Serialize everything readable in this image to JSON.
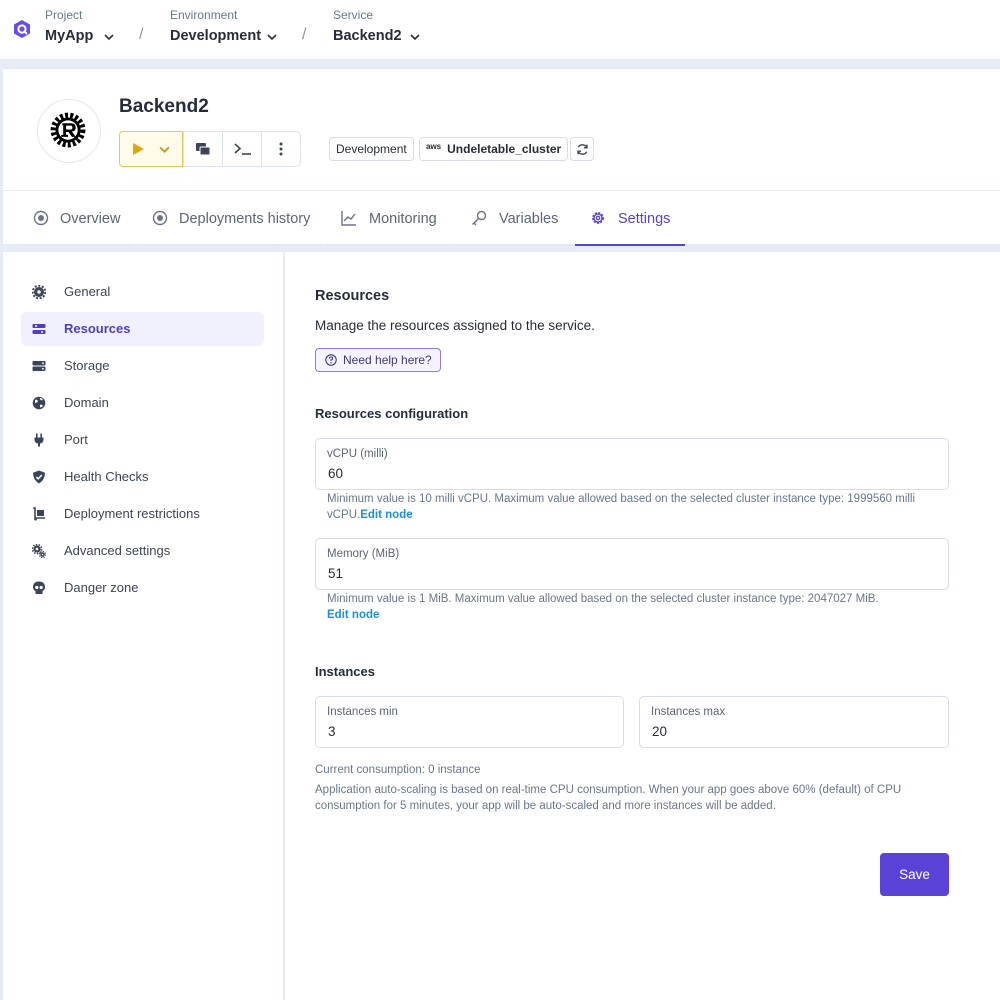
{
  "breadcrumb": {
    "project": {
      "label": "Project",
      "value": "MyApp"
    },
    "environment": {
      "label": "Environment",
      "value": "Development"
    },
    "service": {
      "label": "Service",
      "value": "Backend2"
    },
    "separator": "/"
  },
  "service_header": {
    "title": "Backend2",
    "environment_tag": "Development",
    "cluster_provider": "aws",
    "cluster_tag": "Undeletable_cluster"
  },
  "tabs": [
    {
      "label": "Overview",
      "icon": "circle-dot-icon"
    },
    {
      "label": "Deployments history",
      "icon": "circle-dot-icon"
    },
    {
      "label": "Monitoring",
      "icon": "chart-line-icon"
    },
    {
      "label": "Variables",
      "icon": "key-icon"
    },
    {
      "label": "Settings",
      "icon": "gear-icon",
      "active": true
    }
  ],
  "sidebar": {
    "items": [
      {
        "label": "General",
        "icon": "gear-icon"
      },
      {
        "label": "Resources",
        "icon": "sliders-icon",
        "active": true
      },
      {
        "label": "Storage",
        "icon": "hard-drive-icon"
      },
      {
        "label": "Domain",
        "icon": "globe-icon"
      },
      {
        "label": "Port",
        "icon": "plug-icon"
      },
      {
        "label": "Health Checks",
        "icon": "shield-check-icon"
      },
      {
        "label": "Deployment restrictions",
        "icon": "dolly-icon"
      },
      {
        "label": "Advanced settings",
        "icon": "gears-icon"
      },
      {
        "label": "Danger zone",
        "icon": "skull-icon"
      }
    ]
  },
  "resources": {
    "title": "Resources",
    "description": "Manage the resources assigned to the service.",
    "help_label": "Need help here?",
    "config_title": "Resources configuration",
    "vcpu": {
      "label": "vCPU (milli)",
      "value": "60",
      "hint": "Minimum value is 10 milli vCPU. Maximum value allowed based on the selected cluster instance type: 1999560 milli vCPU.",
      "link": "Edit node"
    },
    "memory": {
      "label": "Memory (MiB)",
      "value": "51",
      "hint": "Minimum value is 1 MiB. Maximum value allowed based on the selected cluster instance type: 2047027 MiB.",
      "link": "Edit node"
    },
    "instances_title": "Instances",
    "instances_min": {
      "label": "Instances min",
      "value": "3"
    },
    "instances_max": {
      "label": "Instances max",
      "value": "20"
    },
    "consumption": "Current consumption: 0 instance",
    "autoscale_note": "Application auto-scaling is based on real-time CPU consumption. When your app goes above 60% (default) of CPU consumption for 5 minutes, your app will be auto-scaled and more instances will be added.",
    "save_label": "Save"
  },
  "colors": {
    "accent": "#5a42d7",
    "play": "#e2a50b",
    "link": "#1d8fd6"
  }
}
